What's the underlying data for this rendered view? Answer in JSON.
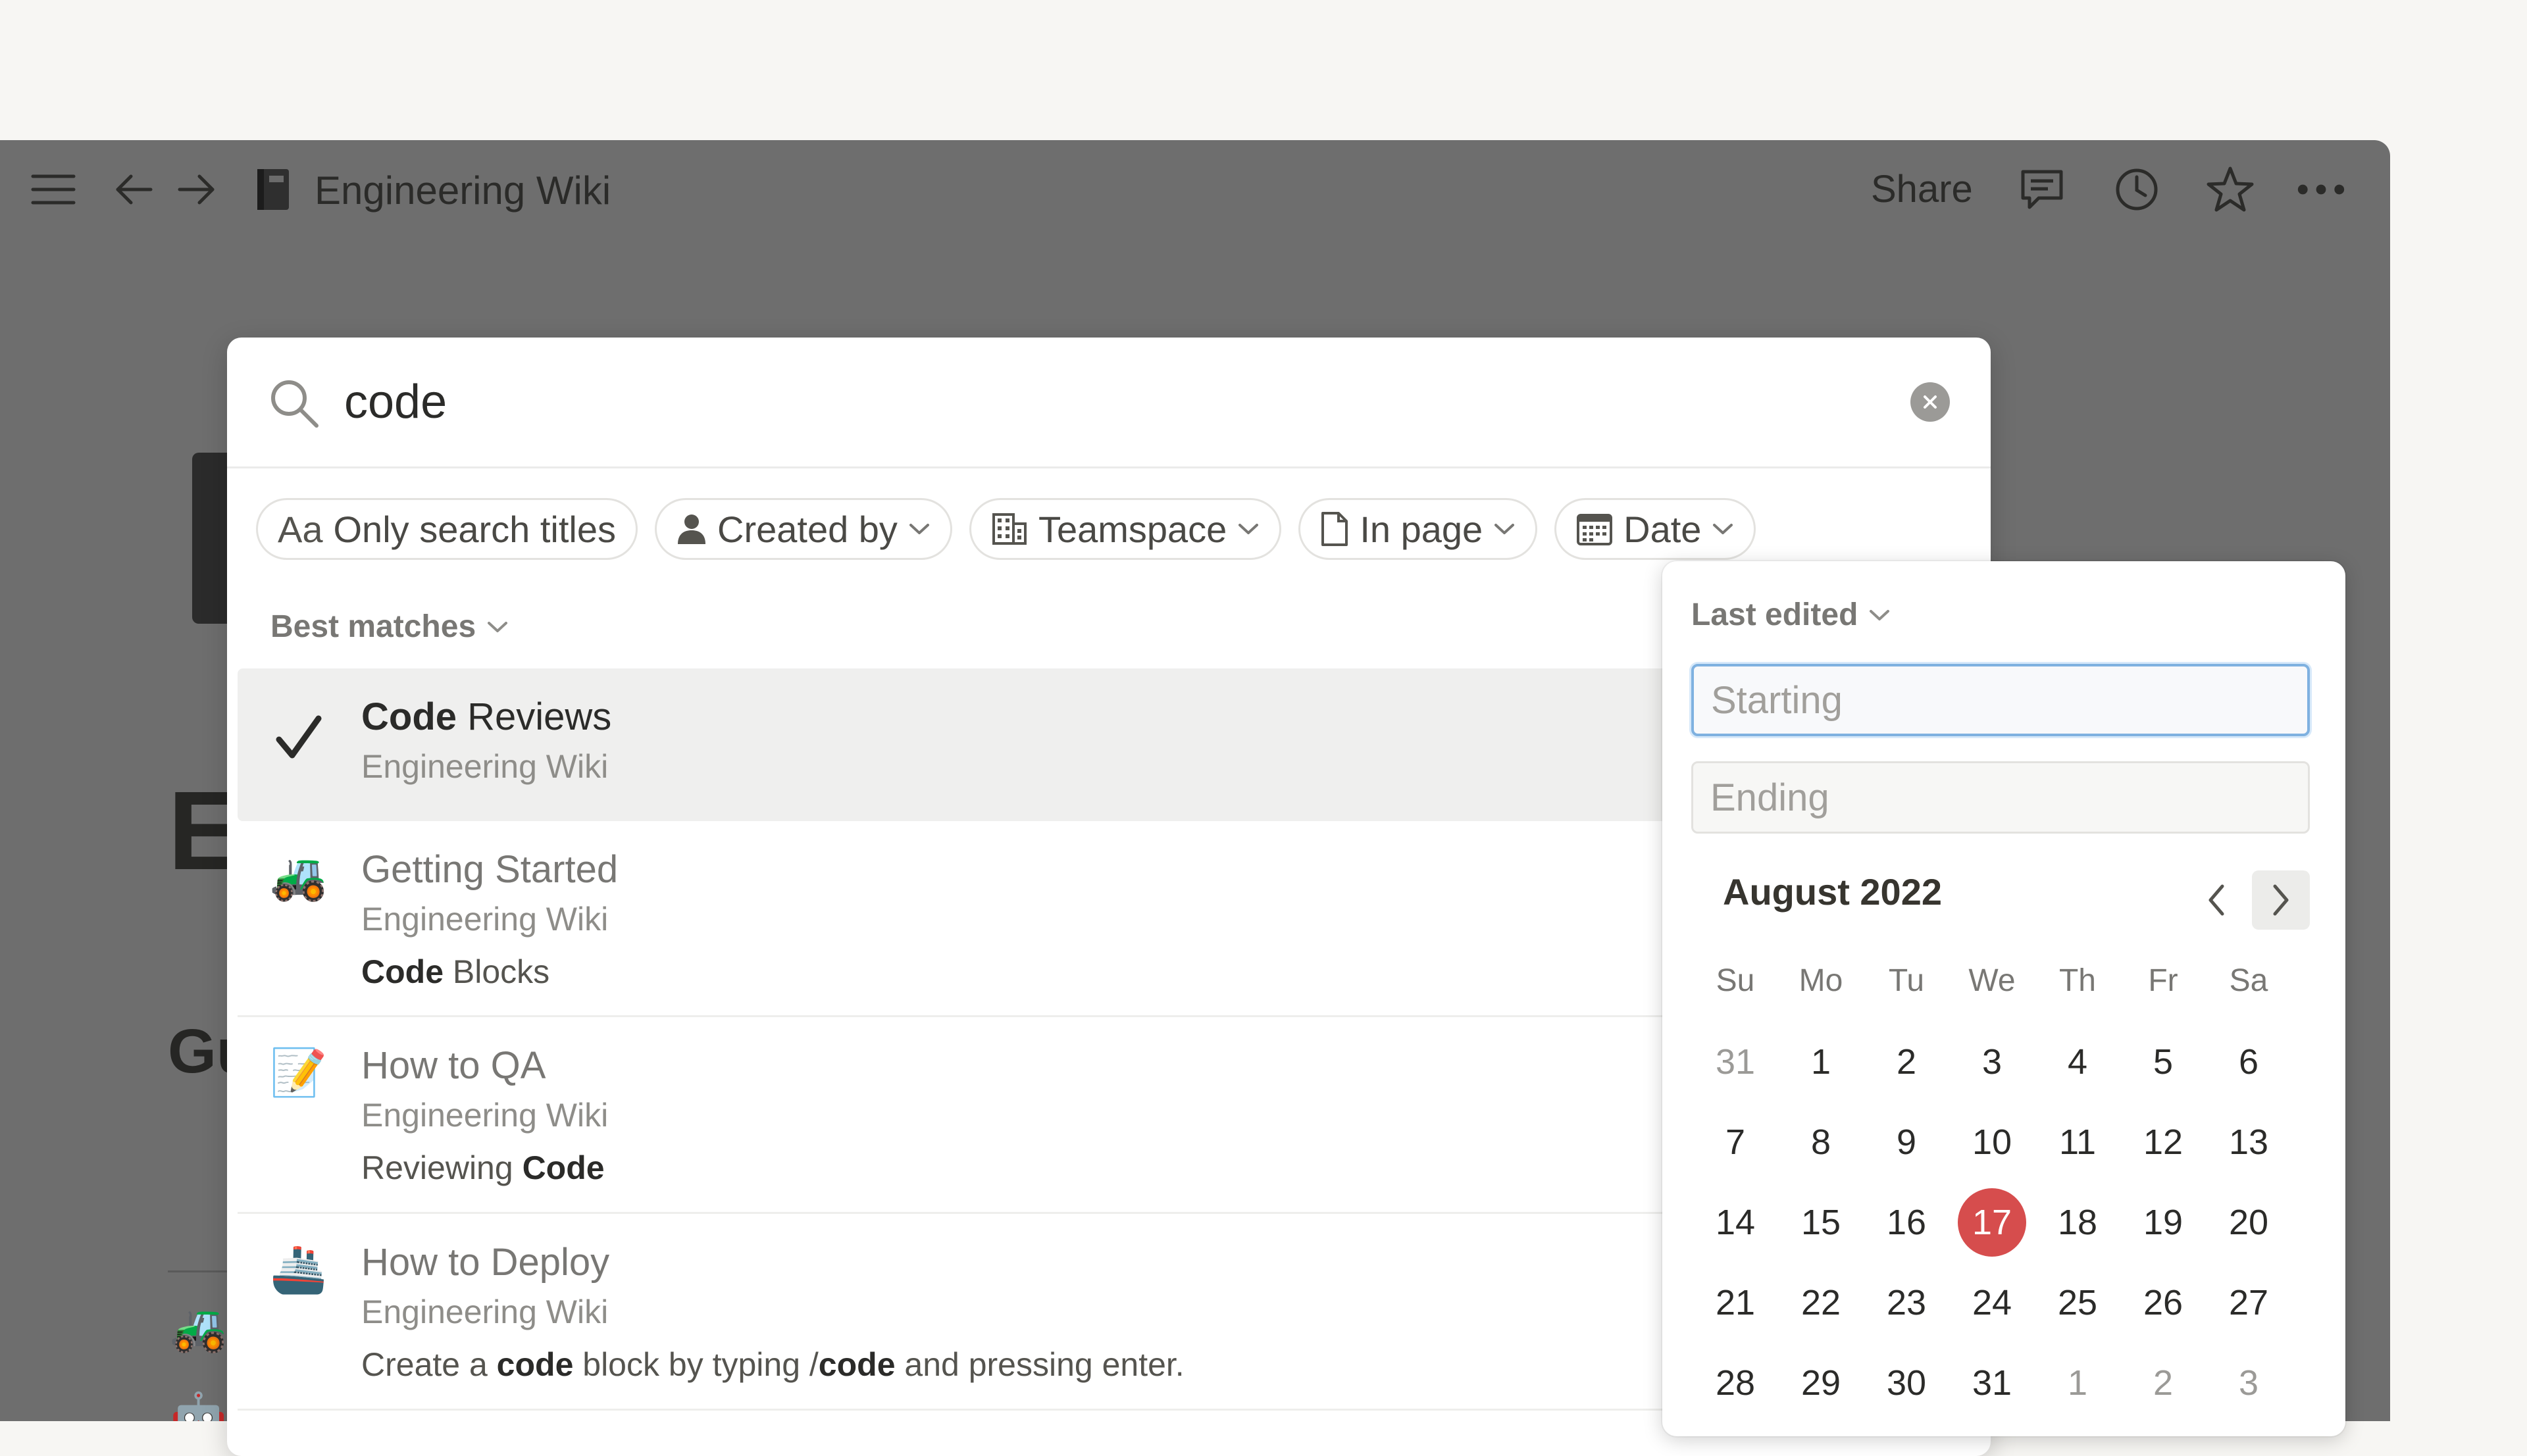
{
  "topbar": {
    "title": "Engineering Wiki",
    "share_label": "Share",
    "icons": [
      "menu-icon",
      "back-arrow-icon",
      "forward-arrow-icon",
      "book-icon",
      "comment-icon",
      "clock-icon",
      "star-icon",
      "more-icon"
    ]
  },
  "background_page": {
    "icons": [
      "tractor-icon",
      "robot-icon",
      "refresh-icon"
    ]
  },
  "search": {
    "query": "code",
    "placeholder": ""
  },
  "filters": [
    {
      "prefix": "Aa",
      "label": "Only search titles",
      "icon": "aa-icon"
    },
    {
      "label": "Created by",
      "icon": "person-icon"
    },
    {
      "label": "Teamspace",
      "icon": "building-icon"
    },
    {
      "label": "In page",
      "icon": "page-icon"
    },
    {
      "label": "Date",
      "icon": "calendar-icon"
    }
  ],
  "results_section": {
    "label": "Best matches"
  },
  "results": [
    {
      "icon": "checkmark-icon",
      "title_match": "Code",
      "title_rest": " Reviews",
      "path": "Engineering Wiki",
      "snippet_before": "",
      "snippet_match": "",
      "snippet_after": ""
    },
    {
      "icon": "tractor-icon",
      "title": "Getting Started",
      "path": "Engineering Wiki",
      "snippet_before": "",
      "snippet_match": "Code",
      "snippet_after": " Blocks"
    },
    {
      "icon": "memo-icon",
      "title": "How to QA",
      "path": "Engineering Wiki",
      "snippet_before": "Reviewing ",
      "snippet_match": "Code",
      "snippet_after": ""
    },
    {
      "icon": "ship-icon",
      "title": "How to Deploy",
      "path": "Engineering Wiki",
      "snippet_1": "Create a ",
      "snippet_m1": "code",
      "snippet_2": " block by typing /",
      "snippet_m2": "code",
      "snippet_3": " and pressing enter."
    }
  ],
  "date_filter": {
    "mode_label": "Last edited",
    "starting_placeholder": "Starting",
    "ending_placeholder": "Ending",
    "month_label": "August 2022",
    "weekdays": [
      "Su",
      "Mo",
      "Tu",
      "We",
      "Th",
      "Fr",
      "Sa"
    ],
    "days": [
      {
        "d": "31",
        "muted": true
      },
      {
        "d": "1"
      },
      {
        "d": "2"
      },
      {
        "d": "3"
      },
      {
        "d": "4"
      },
      {
        "d": "5"
      },
      {
        "d": "6"
      },
      {
        "d": "7"
      },
      {
        "d": "8"
      },
      {
        "d": "9"
      },
      {
        "d": "10"
      },
      {
        "d": "11"
      },
      {
        "d": "12"
      },
      {
        "d": "13"
      },
      {
        "d": "14"
      },
      {
        "d": "15"
      },
      {
        "d": "16"
      },
      {
        "d": "17",
        "today": true
      },
      {
        "d": "18"
      },
      {
        "d": "19"
      },
      {
        "d": "20"
      },
      {
        "d": "21"
      },
      {
        "d": "22"
      },
      {
        "d": "23"
      },
      {
        "d": "24"
      },
      {
        "d": "25"
      },
      {
        "d": "26"
      },
      {
        "d": "27"
      },
      {
        "d": "28"
      },
      {
        "d": "29"
      },
      {
        "d": "30"
      },
      {
        "d": "31"
      },
      {
        "d": "1",
        "muted": true
      },
      {
        "d": "2",
        "muted": true
      },
      {
        "d": "3",
        "muted": true
      }
    ],
    "today_color": "#d64d4d"
  }
}
